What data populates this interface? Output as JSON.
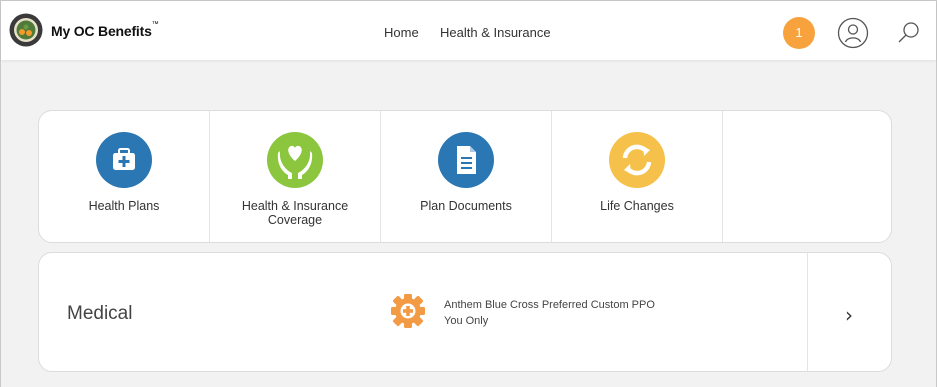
{
  "header": {
    "brand": "My OC Benefits",
    "trademark": "™",
    "nav": [
      {
        "label": "Home"
      },
      {
        "label": "Health & Insurance"
      }
    ],
    "notification_count": "1",
    "notification_color": "#f7a23c",
    "icons": {
      "user": "user-icon",
      "search": "search-icon",
      "logo": "county-seal-logo"
    }
  },
  "tiles": [
    {
      "label": "Health Plans",
      "icon": "medical-kit-icon",
      "color": "#2b77b3"
    },
    {
      "label": "Health & Insurance Coverage",
      "icon": "hands-heart-icon",
      "color": "#8cc63f"
    },
    {
      "label": "Plan Documents",
      "icon": "document-icon",
      "color": "#2b77b3"
    },
    {
      "label": "Life Changes",
      "icon": "refresh-icon",
      "color": "#f5c14a"
    },
    {
      "label": ""
    }
  ],
  "medical": {
    "title": "Medical",
    "plan_name": "Anthem Blue Cross Preferred Custom PPO",
    "coverage": "You Only",
    "icon": "medical-gear-icon",
    "icon_color": "#f39a45",
    "chevron": "›"
  }
}
